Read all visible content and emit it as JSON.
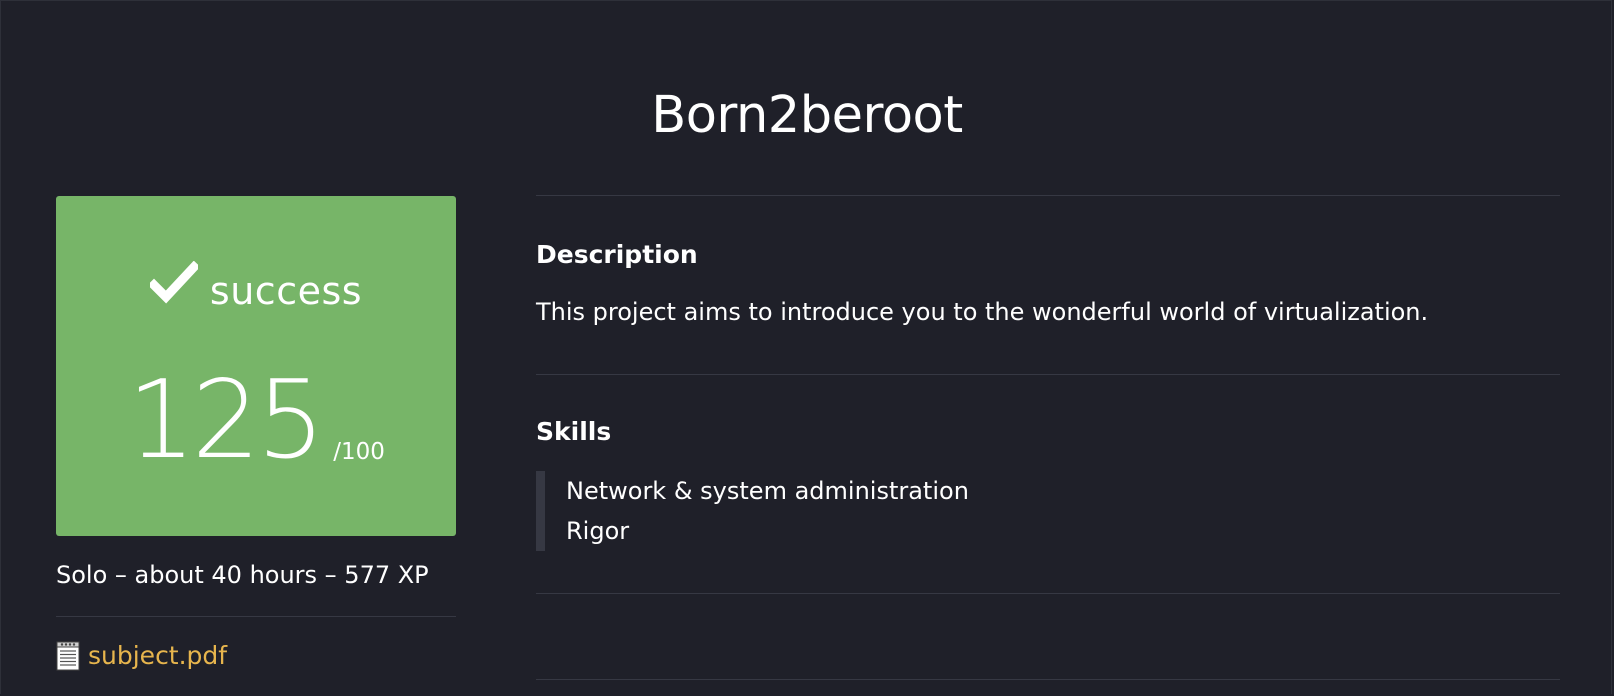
{
  "project": {
    "title": "Born2beroot"
  },
  "result": {
    "status": "success",
    "score": "125",
    "max_score": "/100",
    "color": "#77b568"
  },
  "meta": {
    "text": "Solo – about 40 hours – 577 XP"
  },
  "attachment": {
    "icon": "document-icon",
    "label": "subject.pdf",
    "color": "#e7b54d"
  },
  "description": {
    "heading": "Description",
    "text": "This project aims to introduce you to the wonderful world of virtualization."
  },
  "skills": {
    "heading": "Skills",
    "items": [
      "Network & system administration",
      "Rigor"
    ]
  },
  "theme": {
    "background": "#1f2029",
    "divider": "#363843"
  }
}
